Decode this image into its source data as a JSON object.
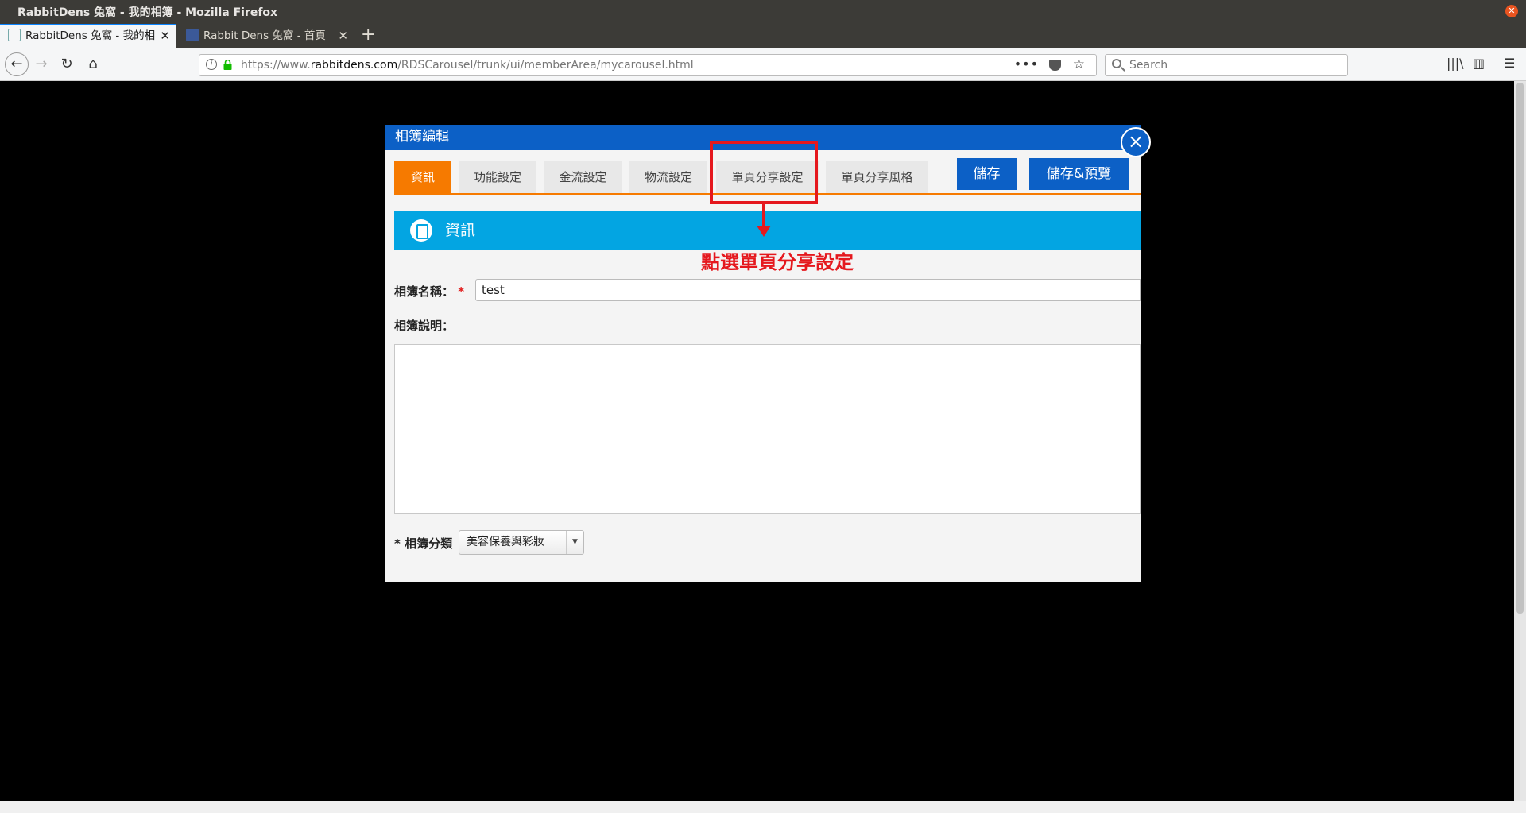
{
  "window": {
    "title": "RabbitDens 兔窩 - 我的相簿 - Mozilla Firefox"
  },
  "tabs": [
    {
      "label": "RabbitDens 兔窩 - 我的相",
      "active": true
    },
    {
      "label": "Rabbit Dens 兔窩 - 首頁",
      "active": false
    }
  ],
  "urlbar": {
    "prefix": "https://www.",
    "domain": "rabbitdens.com",
    "path": "/RDSCarousel/trunk/ui/memberArea/mycarousel.html"
  },
  "search": {
    "placeholder": "Search"
  },
  "modal": {
    "title": "相簿編輯",
    "close": "×",
    "tabs": [
      "資訊",
      "功能設定",
      "金流設定",
      "物流設定",
      "單頁分享設定",
      "單頁分享風格"
    ],
    "save_label": "儲存",
    "save_preview_label": "儲存&預覽",
    "section_title": "資訊",
    "name_label": "相簿名稱：",
    "required_mark": "*",
    "name_value": "test",
    "desc_label": "相簿說明：",
    "category_label": "* 相簿分類",
    "category_value": "美容保養與彩妝"
  },
  "annotation": {
    "text": "點選單頁分享設定",
    "color": "#e5181e"
  },
  "colors": {
    "accent_orange": "#f67a00",
    "header_blue": "#0c60c6",
    "section_blue": "#03a5e2"
  }
}
